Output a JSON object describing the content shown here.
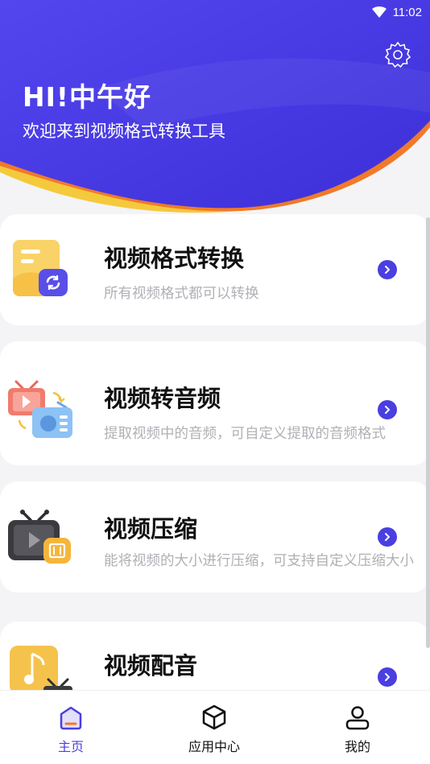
{
  "status_bar": {
    "time": "11:02"
  },
  "header": {
    "greeting": "HI!中午好",
    "subtitle": "欢迎来到视频格式转换工具",
    "colors": {
      "primary": "#4b3fe3",
      "accent": "#f07a2a",
      "yellow": "#f3c83a"
    }
  },
  "cards": [
    {
      "title": "视频格式转换",
      "desc": "所有视频格式都可以转换",
      "icon": "video-format-convert-icon"
    },
    {
      "title": "视频转音频",
      "desc": "提取视频中的音频，可自定义提取的音频格式",
      "icon": "video-to-audio-icon"
    },
    {
      "title": "视频压缩",
      "desc": "能将视频的大小进行压缩，可支持自定义压缩大小",
      "icon": "video-compress-icon"
    },
    {
      "title": "视频配音",
      "desc": "",
      "icon": "video-dubbing-icon"
    }
  ],
  "bottom_nav": [
    {
      "label": "主页",
      "icon": "home-icon",
      "active": true
    },
    {
      "label": "应用中心",
      "icon": "cube-icon",
      "active": false
    },
    {
      "label": "我的",
      "icon": "user-icon",
      "active": false
    }
  ],
  "accent_color": "#4a3fe0"
}
